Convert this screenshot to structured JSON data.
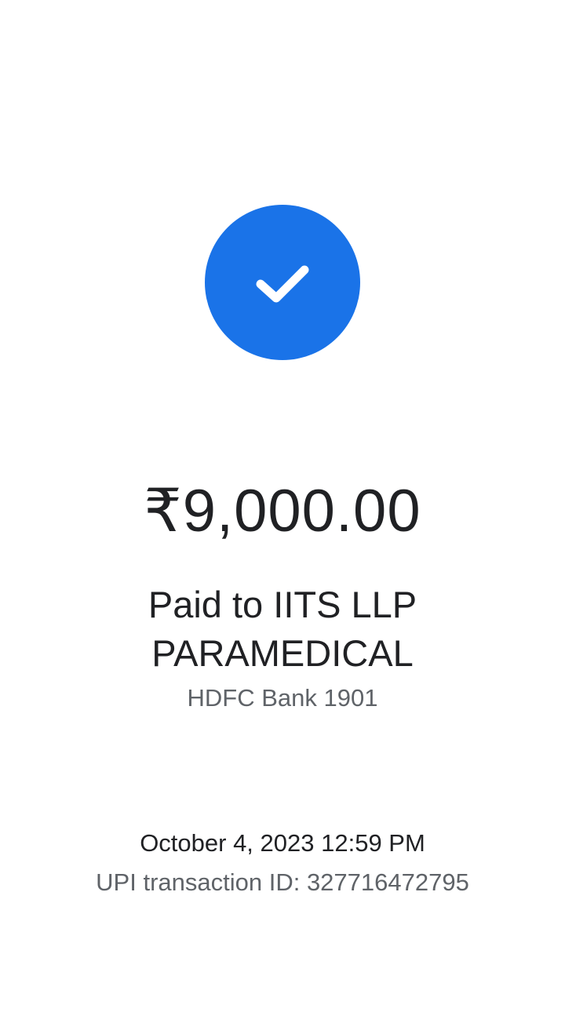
{
  "status": {
    "icon": "check-icon",
    "color": "#1a73e8"
  },
  "payment": {
    "amount": "₹9,000.00",
    "paid_to": "Paid to IITS LLP PARAMEDICAL",
    "bank": "HDFC Bank 1901"
  },
  "transaction": {
    "datetime": "October 4, 2023 12:59 PM",
    "upi_id": "UPI transaction ID: 327716472795"
  }
}
